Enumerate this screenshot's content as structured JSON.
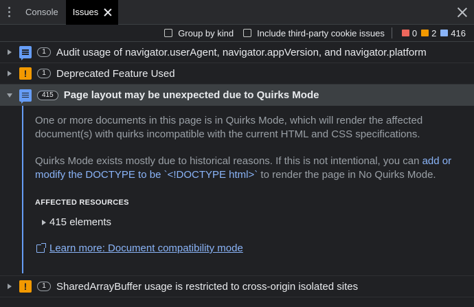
{
  "tabs": [
    {
      "label": "Console",
      "active": false
    },
    {
      "label": "Issues",
      "active": true
    }
  ],
  "toolbar": {
    "group_by_kind": "Group by kind",
    "third_party": "Include third-party cookie issues",
    "counts": {
      "errors": "0",
      "warnings": "2",
      "info": "416"
    }
  },
  "issues": [
    {
      "kind": "info",
      "count": "1",
      "title": "Audit usage of navigator.userAgent, navigator.appVersion, and navigator.platform",
      "expanded": false
    },
    {
      "kind": "warning",
      "count": "1",
      "title": "Deprecated Feature Used",
      "expanded": false
    },
    {
      "kind": "info",
      "count": "415",
      "title": "Page layout may be unexpected due to Quirks Mode",
      "expanded": true
    },
    {
      "kind": "warning",
      "count": "1",
      "title": "SharedArrayBuffer usage is restricted to cross-origin isolated sites",
      "expanded": false
    }
  ],
  "detail": {
    "para1": "One or more documents in this page is in Quirks Mode, which will render the affected document(s) with quirks incompatible with the current HTML and CSS specifications.",
    "para2_prefix": "Quirks Mode exists mostly due to historical reasons. If this is not intentional, you can ",
    "para2_link": "add or modify the DOCTYPE to be `<!DOCTYPE html>`",
    "para2_suffix": " to render the page in No Quirks Mode.",
    "affected_title": "AFFECTED RESOURCES",
    "affected_count": "415 elements",
    "learn_more": "Learn more: Document compatibility mode"
  },
  "colors": {
    "background": "#202124",
    "info": "#669df6",
    "warning": "#f29900",
    "error": "#ee675c",
    "link": "#8ab4f8"
  }
}
